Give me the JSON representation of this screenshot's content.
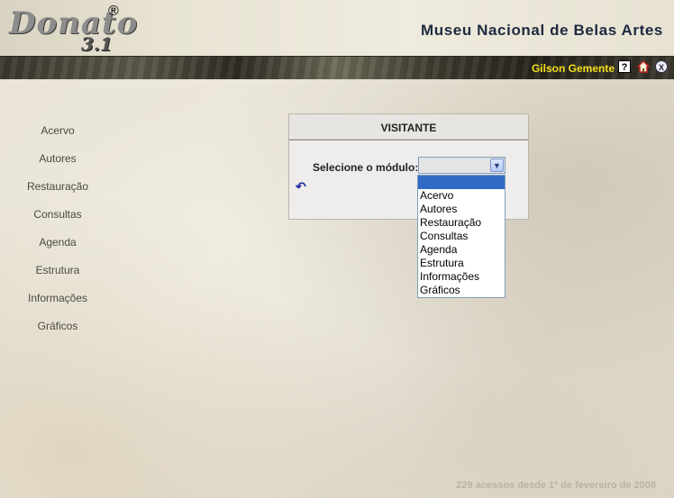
{
  "header": {
    "logo_text": "Donato",
    "logo_version": "3.1",
    "logo_registered": "®",
    "museum_name": "Museu Nacional de Belas Artes"
  },
  "userbar": {
    "username": "Gilson Gemente",
    "help_glyph": "?",
    "home_glyph": "⌂",
    "close_glyph": "X"
  },
  "sidebar": {
    "items": [
      {
        "label": "Acervo"
      },
      {
        "label": "Autores"
      },
      {
        "label": "Restauração"
      },
      {
        "label": "Consultas"
      },
      {
        "label": "Agenda"
      },
      {
        "label": "Estrutura"
      },
      {
        "label": "Informações"
      },
      {
        "label": "Gráficos"
      }
    ]
  },
  "panel": {
    "title": "VISITANTE",
    "select_label": "Selecione o módulo:",
    "selected_value": "",
    "undo_glyph": "↶"
  },
  "dropdown": {
    "options": [
      "",
      "Acervo",
      "Autores",
      "Restauração",
      "Consultas",
      "Agenda",
      "Estrutura",
      "Informações",
      "Gráficos"
    ]
  },
  "footer": {
    "text": "229 acessos desde 1º de fevereiro de 2008"
  }
}
